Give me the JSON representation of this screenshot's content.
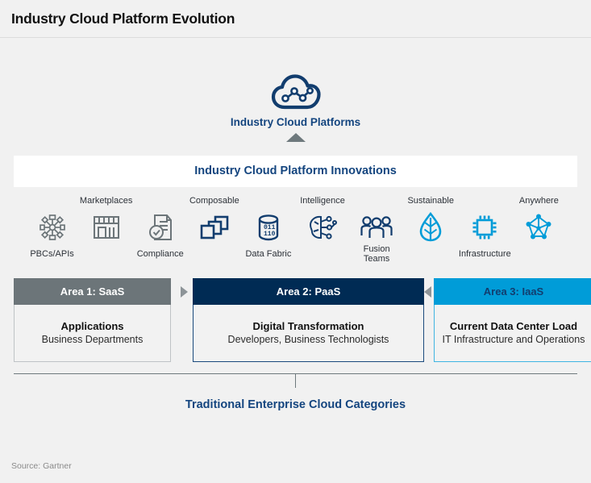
{
  "title": "Industry Cloud Platform Evolution",
  "hero": {
    "icon": "cloud-network-icon",
    "label": "Industry Cloud Platforms",
    "arrow": "up-arrow-icon"
  },
  "innovations": {
    "title": "Industry Cloud Platform Innovations",
    "columns": [
      {
        "top_label": "",
        "bottom_label": "PBCs/APIs",
        "icon": "hub-nodes-icon",
        "color": "#6c7579"
      },
      {
        "top_label": "Marketplaces",
        "bottom_label": "",
        "icon": "storefront-icon",
        "color": "#6c7579"
      },
      {
        "top_label": "",
        "bottom_label": "Compliance",
        "icon": "document-check-icon",
        "color": "#6c7579"
      },
      {
        "top_label": "Composable",
        "bottom_label": "",
        "icon": "stacked-squares-icon",
        "color": "#123d6e"
      },
      {
        "top_label": "",
        "bottom_label": "Data Fabric",
        "icon": "database-icon",
        "color": "#123d6e"
      },
      {
        "top_label": "Intelligence",
        "bottom_label": "",
        "icon": "brain-circuit-icon",
        "color": "#123d6e"
      },
      {
        "top_label": "",
        "bottom_label": "Fusion Teams",
        "icon": "people-group-icon",
        "color": "#123d6e"
      },
      {
        "top_label": "Sustainable",
        "bottom_label": "",
        "icon": "leaf-icon",
        "color": "#009cd8"
      },
      {
        "top_label": "",
        "bottom_label": "Infrastructure",
        "icon": "cpu-chip-icon",
        "color": "#009cd8"
      },
      {
        "top_label": "Anywhere",
        "bottom_label": "",
        "icon": "network-mesh-icon",
        "color": "#009cd8"
      }
    ]
  },
  "areas": [
    {
      "header": "Area 1: SaaS",
      "line1": "Applications",
      "line2": "Business Departments",
      "header_bg": "#6c7579",
      "header_fg": "#ffffff"
    },
    {
      "header": "Area 2: PaaS",
      "line1": "Digital Transformation",
      "line2": "Developers, Business Technologists",
      "header_bg": "#002b54",
      "header_fg": "#ffffff"
    },
    {
      "header": "Area 3: IaaS",
      "line1": "Current Data Center Load",
      "line2": "IT Infrastructure and Operations",
      "header_bg": "#009cd8",
      "header_fg": "#123d6e"
    }
  ],
  "connectors": {
    "right_arrow": "triangle-right-icon",
    "left_arrow": "triangle-left-icon"
  },
  "bottom_label": "Traditional Enterprise Cloud Categories",
  "source": "Source: Gartner",
  "colors": {
    "background": "#f1f1f1",
    "navy": "#14457f",
    "dark_navy": "#002b54",
    "cyan": "#009cd8",
    "gray": "#6c7579"
  }
}
